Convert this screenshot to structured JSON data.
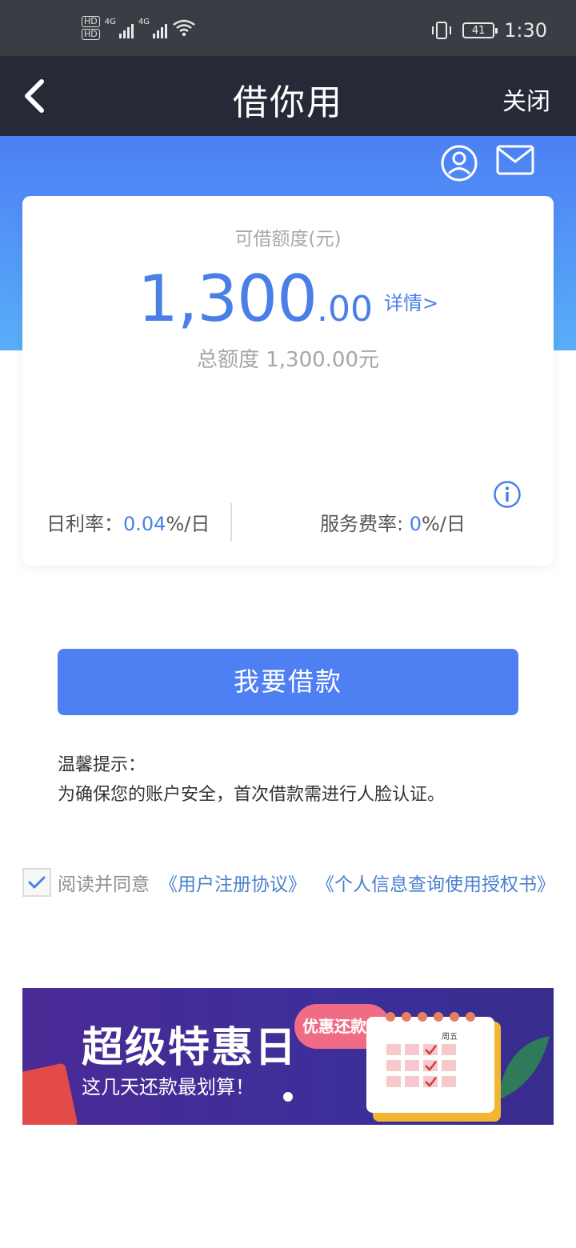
{
  "status_bar": {
    "hd1": "HD",
    "hd2": "HD",
    "net1": "4G",
    "net2": "4G",
    "battery": "41",
    "time": "1:30"
  },
  "navbar": {
    "back_icon": "chevron-left-icon",
    "title": "借你用",
    "close_label": "关闭"
  },
  "header_icons": [
    "user-icon",
    "mail-icon"
  ],
  "credit": {
    "label": "可借额度(元)",
    "amount_int": "1,300",
    "amount_dec": ".00",
    "detail_link": "详情>",
    "total": "总额度 1,300.00元",
    "daily_rate_label": "日利率：",
    "daily_rate_value": "0.04",
    "daily_rate_unit": "%/日",
    "service_rate_label": "服务费率: ",
    "service_rate_value": "0",
    "service_rate_unit": "%/日"
  },
  "borrow_button": "我要借款",
  "tips": {
    "title": "温馨提示：",
    "text": "为确保您的账户安全，首次借款需进行人脸认证。"
  },
  "agreement": {
    "checked": true,
    "prefix": "阅读并同意",
    "link1": "《用户注册协议》",
    "link2": "《个人信息查询使用授权书》"
  },
  "banner": {
    "title": "超级特惠日",
    "subtitle": "这几天还款最划算！",
    "pill": "优惠还款！",
    "calendar_label": "周五"
  },
  "colors": {
    "accent": "#4a7fe8",
    "navbar": "#262a36",
    "statusbar": "#3a3d44",
    "button": "#4e7ff3"
  }
}
